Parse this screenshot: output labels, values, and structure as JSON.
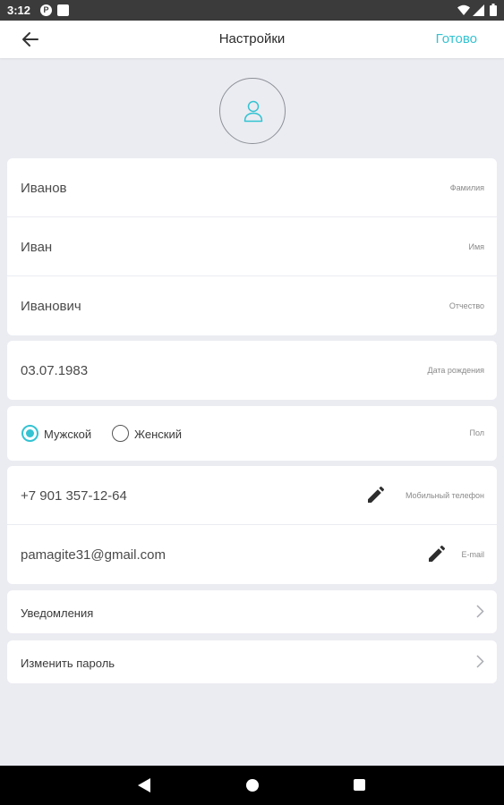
{
  "status_bar": {
    "time": "3:12",
    "p_badge": "P"
  },
  "header": {
    "title": "Настройки",
    "done_label": "Готово"
  },
  "accent_color": "#33c3d2",
  "personal": [
    {
      "value": "Иванов",
      "label": "Фамилия"
    },
    {
      "value": "Иван",
      "label": "Имя"
    },
    {
      "value": "Иванович",
      "label": "Отчество"
    }
  ],
  "birthdate": {
    "value": "03.07.1983",
    "label": "Дата рождения"
  },
  "gender": {
    "label": "Пол",
    "options": [
      "Мужской",
      "Женский"
    ],
    "selected": "Мужской"
  },
  "contacts": [
    {
      "value": "+7 901 357-12-64",
      "label": "Мобильный телефон"
    },
    {
      "value": "pamagite31@gmail.com",
      "label": "E-mail"
    }
  ],
  "links": {
    "notifications": "Уведомления",
    "change_password": "Изменить пароль"
  }
}
